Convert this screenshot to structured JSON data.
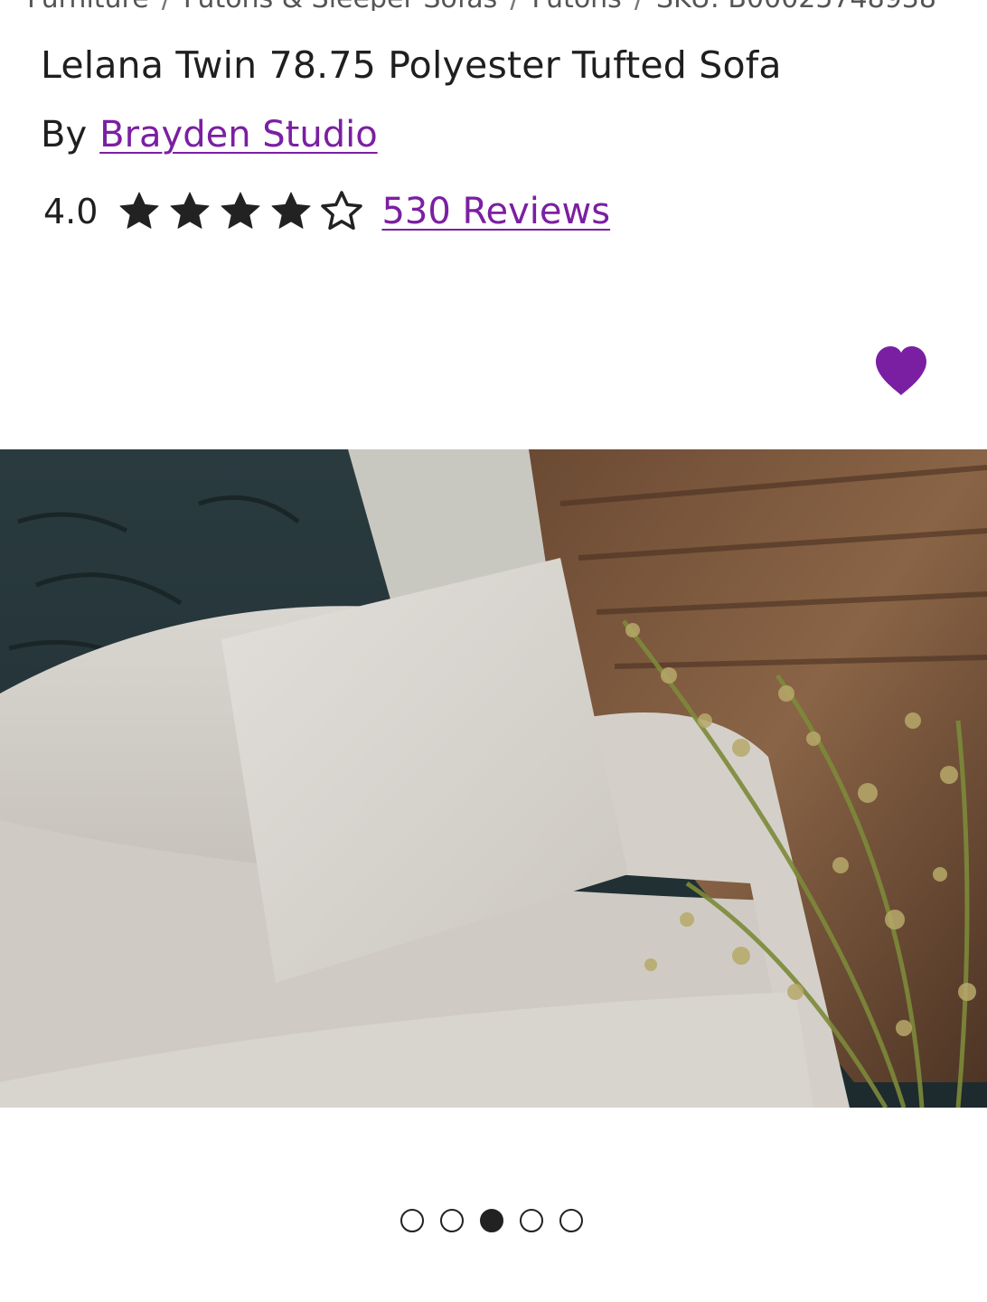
{
  "breadcrumb": {
    "items": [
      "Furniture",
      "Futons & Sleeper Sofas",
      "Futons",
      "SKU: B00025748938"
    ],
    "separator": "/"
  },
  "product": {
    "title": "Lelana Twin 78.75 Polyester Tufted Sofa",
    "by_prefix": "By",
    "brand": "Brayden Studio",
    "rating_value": "4.0",
    "rating": 4,
    "rating_max": 5,
    "reviews_label": "530 Reviews",
    "image_alt": "Light gray sofa with a throw pillow beside a plant"
  },
  "carousel": {
    "total": 5,
    "active_index": 2
  },
  "colors": {
    "accent": "#7b1fa2",
    "text": "#1f1f1f"
  },
  "icons": {
    "favorite": "heart-icon",
    "star_filled": "star-filled-icon",
    "star_empty": "star-outline-icon"
  }
}
